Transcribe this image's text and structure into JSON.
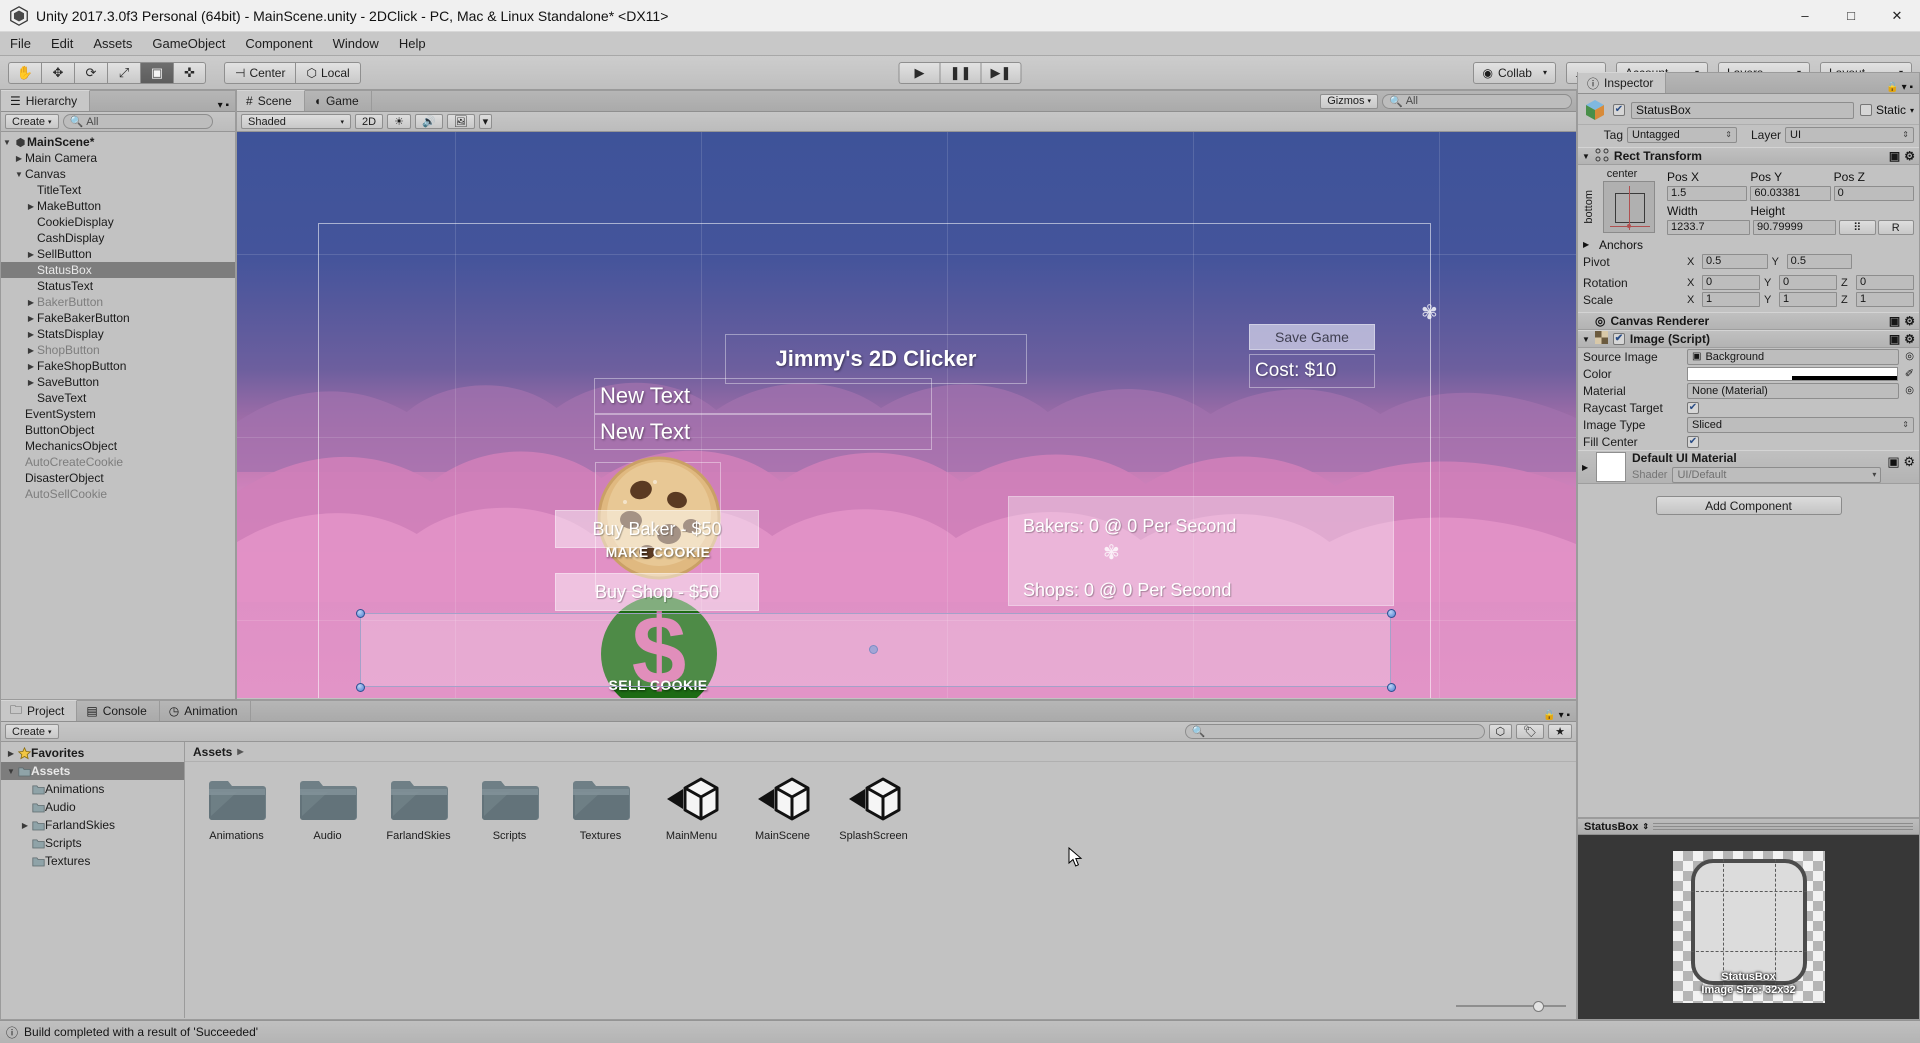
{
  "window": {
    "title": "Unity 2017.3.0f3 Personal (64bit) - MainScene.unity - 2DClick - PC, Mac & Linux Standalone* <DX11>",
    "minimize": "–",
    "maximize": "□",
    "close": "✕",
    "logo_icon": "unity-logo-icon"
  },
  "menubar": {
    "items": [
      "File",
      "Edit",
      "Assets",
      "GameObject",
      "Component",
      "Window",
      "Help"
    ]
  },
  "toolbar": {
    "tools": [
      {
        "name": "hand-tool",
        "glyph": "✋"
      },
      {
        "name": "move-tool",
        "glyph": "✥"
      },
      {
        "name": "rotate-tool",
        "glyph": "⟳"
      },
      {
        "name": "scale-tool",
        "glyph": "⤢"
      },
      {
        "name": "rect-tool",
        "glyph": "▣"
      },
      {
        "name": "transform-tool",
        "glyph": "✜"
      }
    ],
    "pivot": "Center",
    "space": "Local",
    "play": "▶",
    "pause": "❚❚",
    "step": "▶❚",
    "collab": "Collab",
    "cloud": "☁",
    "account": "Account",
    "layers": "Layers",
    "layout": "Layout"
  },
  "hierarchy": {
    "tab": "Hierarchy",
    "create_label": "Create",
    "search_placeholder": "All",
    "root": "MainScene*",
    "items": [
      {
        "label": "Main Camera",
        "depth": 1,
        "arrow": true,
        "dim": false,
        "selected": false
      },
      {
        "label": "Canvas",
        "depth": 1,
        "arrow": true,
        "dim": false,
        "selected": false,
        "expanded": true
      },
      {
        "label": "TitleText",
        "depth": 2,
        "arrow": false,
        "dim": false,
        "selected": false
      },
      {
        "label": "MakeButton",
        "depth": 2,
        "arrow": true,
        "dim": false,
        "selected": false
      },
      {
        "label": "CookieDisplay",
        "depth": 2,
        "arrow": false,
        "dim": false,
        "selected": false
      },
      {
        "label": "CashDisplay",
        "depth": 2,
        "arrow": false,
        "dim": false,
        "selected": false
      },
      {
        "label": "SellButton",
        "depth": 2,
        "arrow": true,
        "dim": false,
        "selected": false
      },
      {
        "label": "StatusBox",
        "depth": 2,
        "arrow": false,
        "dim": false,
        "selected": true
      },
      {
        "label": "StatusText",
        "depth": 2,
        "arrow": false,
        "dim": false,
        "selected": false
      },
      {
        "label": "BakerButton",
        "depth": 2,
        "arrow": true,
        "dim": true,
        "selected": false
      },
      {
        "label": "FakeBakerButton",
        "depth": 2,
        "arrow": true,
        "dim": false,
        "selected": false
      },
      {
        "label": "StatsDisplay",
        "depth": 2,
        "arrow": true,
        "dim": false,
        "selected": false
      },
      {
        "label": "ShopButton",
        "depth": 2,
        "arrow": true,
        "dim": true,
        "selected": false
      },
      {
        "label": "FakeShopButton",
        "depth": 2,
        "arrow": true,
        "dim": false,
        "selected": false
      },
      {
        "label": "SaveButton",
        "depth": 2,
        "arrow": true,
        "dim": false,
        "selected": false
      },
      {
        "label": "SaveText",
        "depth": 2,
        "arrow": false,
        "dim": false,
        "selected": false
      },
      {
        "label": "EventSystem",
        "depth": 1,
        "arrow": false,
        "dim": false,
        "selected": false
      },
      {
        "label": "ButtonObject",
        "depth": 1,
        "arrow": false,
        "dim": false,
        "selected": false
      },
      {
        "label": "MechanicsObject",
        "depth": 1,
        "arrow": false,
        "dim": false,
        "selected": false
      },
      {
        "label": "AutoCreateCookie",
        "depth": 1,
        "arrow": false,
        "dim": true,
        "selected": false
      },
      {
        "label": "DisasterObject",
        "depth": 1,
        "arrow": false,
        "dim": false,
        "selected": false
      },
      {
        "label": "AutoSellCookie",
        "depth": 1,
        "arrow": false,
        "dim": true,
        "selected": false
      }
    ]
  },
  "scene": {
    "tabs": [
      {
        "label": "Scene",
        "icon": "grid-icon",
        "active": true
      },
      {
        "label": "Game",
        "icon": "gamepad-icon",
        "active": false
      }
    ],
    "draw_mode": "Shaded",
    "mode_2d": "2D",
    "lighting_icon": "sun-icon",
    "audio_icon": "speaker-icon",
    "fx_icon": "image-icon",
    "gizmos": "Gizmos",
    "search_placeholder": "All",
    "game": {
      "title": "Jimmy's 2D Clicker",
      "cookie_display": "New Text",
      "cash_display": "New Text",
      "make_cookie_label": "MAKE COOKIE",
      "sell_cookie_label": "SELL COOKIE",
      "sell_symbol": "$",
      "buy_baker": "Buy Baker - $50",
      "buy_shop": "Buy Shop - $50",
      "save_game": "Save Game",
      "cost": "Cost: $10",
      "stats_bakers": "Bakers: 0 @ 0 Per Second",
      "stats_shops": "Shops: 0 @ 0 Per Second"
    }
  },
  "inspector": {
    "tab": "Inspector",
    "lock_icon": "lock-icon",
    "menu_icon": "kebab-icon",
    "object_name": "StatusBox",
    "enabled": true,
    "static_label": "Static",
    "static_checked": false,
    "tag_label": "Tag",
    "tag_value": "Untagged",
    "layer_label": "Layer",
    "layer_value": "UI",
    "rect_transform": {
      "title": "Rect Transform",
      "anchor_preset_top": "center",
      "anchor_preset_side": "bottom",
      "pos_x_label": "Pos X",
      "pos_x": "1.5",
      "pos_y_label": "Pos Y",
      "pos_y": "60.03381",
      "pos_z_label": "Pos Z",
      "pos_z": "0",
      "width_label": "Width",
      "width": "1233.7",
      "height_label": "Height",
      "height": "90.79999",
      "blueprint_btn": "⠿",
      "raw_btn": "R",
      "anchors_label": "Anchors",
      "pivot_label": "Pivot",
      "pivot_x": "0.5",
      "pivot_y": "0.5",
      "rotation_label": "Rotation",
      "rot_x": "0",
      "rot_y": "0",
      "rot_z": "0",
      "scale_label": "Scale",
      "scale_x": "1",
      "scale_y": "1",
      "scale_z": "1"
    },
    "canvas_renderer": {
      "title": "Canvas Renderer"
    },
    "image_script": {
      "title": "Image (Script)",
      "enabled": true,
      "source_image_label": "Source Image",
      "source_image": "Background",
      "color_label": "Color",
      "color_value": "#FFFFFF",
      "material_label": "Material",
      "material_value": "None (Material)",
      "raycast_label": "Raycast Target",
      "raycast_checked": true,
      "image_type_label": "Image Type",
      "image_type": "Sliced",
      "fill_center_label": "Fill Center",
      "fill_center_checked": true
    },
    "material": {
      "title": "Default UI Material",
      "shader_label": "Shader",
      "shader_value": "UI/Default"
    },
    "add_component": "Add Component"
  },
  "project": {
    "tabs": [
      {
        "label": "Project",
        "icon": "folder-icon",
        "active": true
      },
      {
        "label": "Console",
        "icon": "console-icon",
        "active": false
      },
      {
        "label": "Animation",
        "icon": "clock-icon",
        "active": false
      }
    ],
    "create_label": "Create",
    "search_placeholder": "",
    "tree": [
      {
        "label": "Favorites",
        "depth": 0,
        "arrow": true,
        "icon": "star-icon",
        "bold": true,
        "selected": false
      },
      {
        "label": "Assets",
        "depth": 0,
        "arrow": true,
        "icon": "folder-icon",
        "bold": true,
        "selected": true
      },
      {
        "label": "Animations",
        "depth": 1,
        "arrow": false,
        "icon": "folder-icon",
        "bold": false,
        "selected": false
      },
      {
        "label": "Audio",
        "depth": 1,
        "arrow": false,
        "icon": "folder-icon",
        "bold": false,
        "selected": false
      },
      {
        "label": "FarlandSkies",
        "depth": 1,
        "arrow": true,
        "icon": "folder-icon",
        "bold": false,
        "selected": false
      },
      {
        "label": "Scripts",
        "depth": 1,
        "arrow": false,
        "icon": "folder-icon",
        "bold": false,
        "selected": false
      },
      {
        "label": "Textures",
        "depth": 1,
        "arrow": false,
        "icon": "folder-icon",
        "bold": false,
        "selected": false
      }
    ],
    "breadcrumb": "Assets",
    "assets": [
      {
        "label": "Animations",
        "type": "folder"
      },
      {
        "label": "Audio",
        "type": "folder"
      },
      {
        "label": "FarlandSkies",
        "type": "folder"
      },
      {
        "label": "Scripts",
        "type": "folder"
      },
      {
        "label": "Textures",
        "type": "folder"
      },
      {
        "label": "MainMenu",
        "type": "scene"
      },
      {
        "label": "MainScene",
        "type": "scene"
      },
      {
        "label": "SplashScreen",
        "type": "scene"
      }
    ]
  },
  "preview": {
    "title": "StatusBox",
    "caption_name": "StatusBox",
    "caption_size": "Image Size: 32x32"
  },
  "statusbar": {
    "icon": "info-icon",
    "message": "Build completed with a result of 'Succeeded'"
  }
}
